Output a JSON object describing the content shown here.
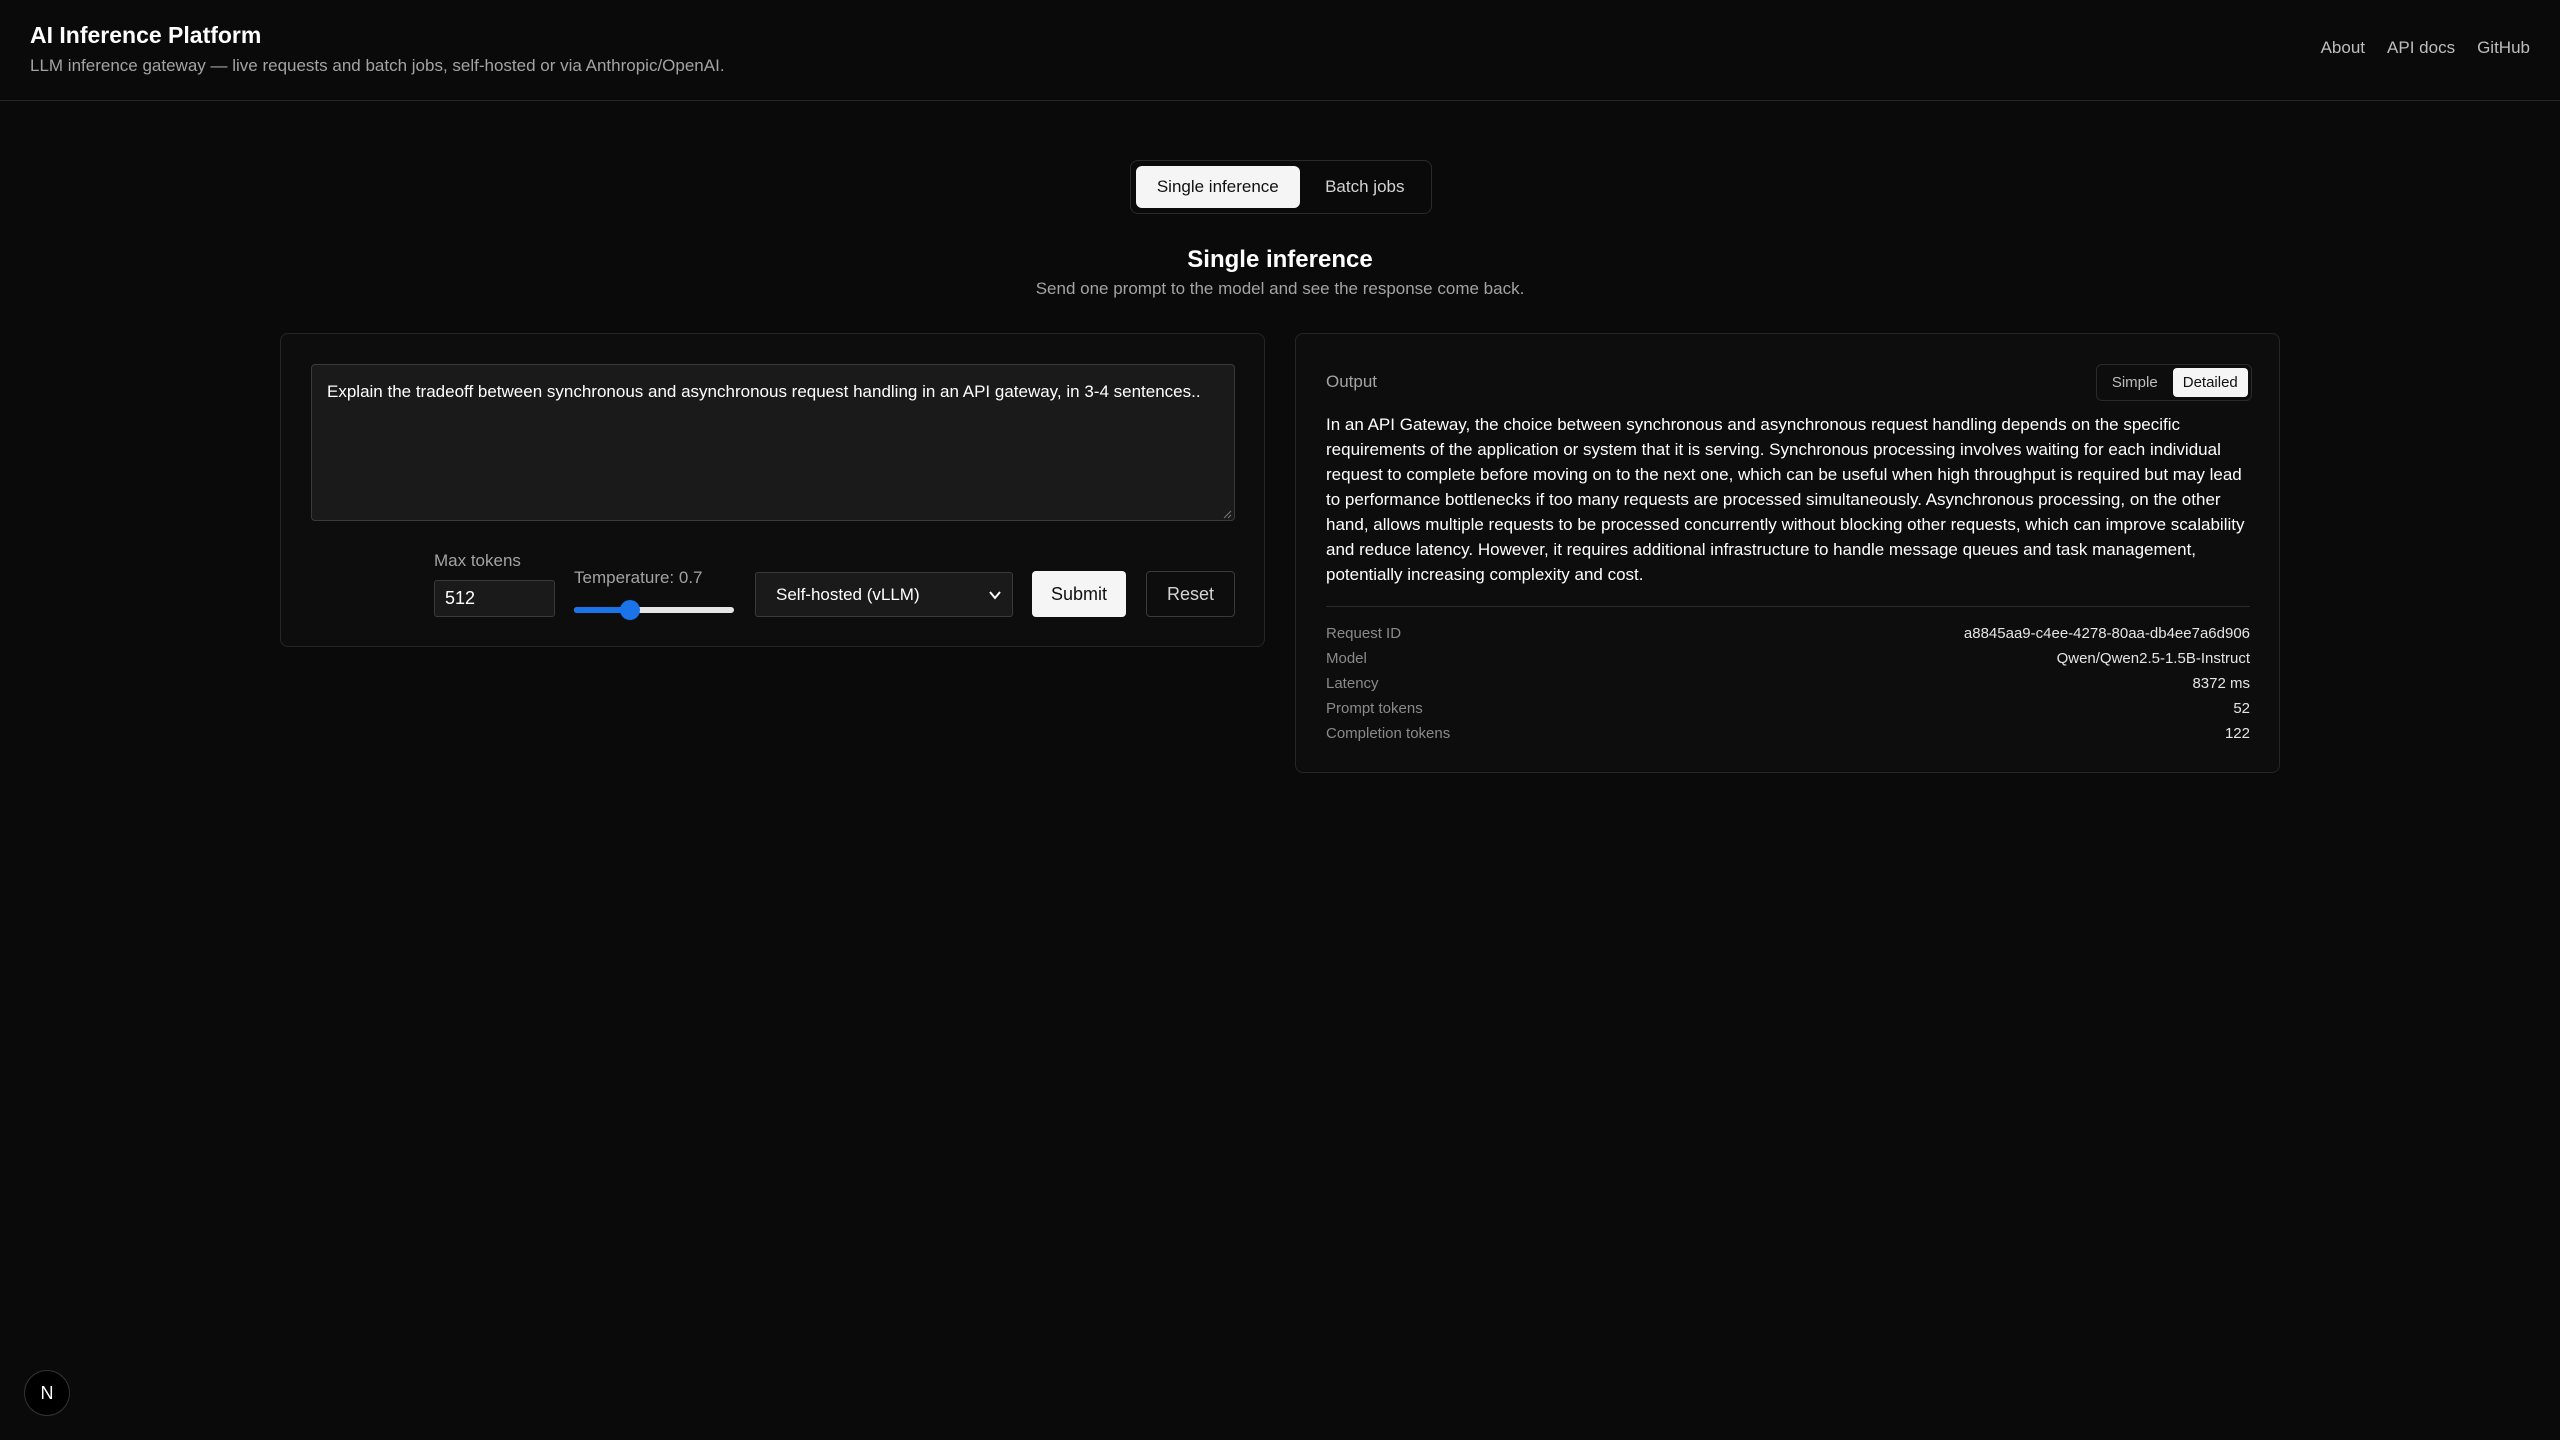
{
  "header": {
    "title": "AI Inference Platform",
    "subtitle": "LLM inference gateway — live requests and batch jobs, self-hosted or via Anthropic/OpenAI.",
    "nav": [
      "About",
      "API docs",
      "GitHub"
    ]
  },
  "mode_tabs": [
    {
      "label": "Single inference",
      "active": true
    },
    {
      "label": "Batch jobs",
      "active": false
    }
  ],
  "section": {
    "title": "Single inference",
    "description": "Send one prompt to the model and see the response come back."
  },
  "form": {
    "prompt": "Explain the tradeoff between synchronous and asynchronous request handling in an API gateway, in 3-4 sentences..",
    "max_tokens_label": "Max tokens",
    "max_tokens_value": "512",
    "temperature_label": "Temperature: 0.7",
    "temperature_fraction": 0.35,
    "model_selected": "Self-hosted (vLLM)",
    "submit_label": "Submit",
    "reset_label": "Reset"
  },
  "output": {
    "label": "Output",
    "view_modes": [
      "Simple",
      "Detailed"
    ],
    "active_view": "Detailed",
    "text": "In an API Gateway, the choice between synchronous and asynchronous request handling depends on the specific requirements of the application or system that it is serving. Synchronous processing involves waiting for each individual request to complete before moving on to the next one, which can be useful when high throughput is required but may lead to performance bottlenecks if too many requests are processed simultaneously. Asynchronous processing, on the other hand, allows multiple requests to be processed concurrently without blocking other requests, which can improve scalability and reduce latency. However, it requires additional infrastructure to handle message queues and task management, potentially increasing complexity and cost.",
    "meta": [
      {
        "key": "Request ID",
        "value": "a8845aa9-c4ee-4278-80aa-db4ee7a6d906"
      },
      {
        "key": "Model",
        "value": "Qwen/Qwen2.5-1.5B-Instruct"
      },
      {
        "key": "Latency",
        "value": "8372 ms"
      },
      {
        "key": "Prompt tokens",
        "value": "52"
      },
      {
        "key": "Completion tokens",
        "value": "122"
      }
    ]
  },
  "badge": {
    "letter": "N"
  },
  "colors": {
    "background": "#0a0a0a",
    "accent": "#1a73e8",
    "border": "#262626"
  }
}
